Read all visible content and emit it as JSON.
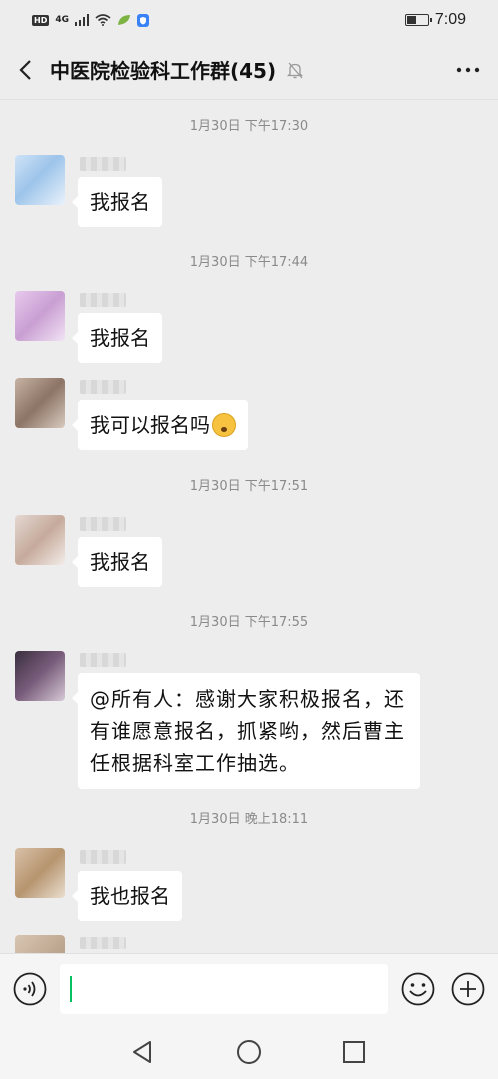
{
  "status_bar": {
    "network_badge": "HD",
    "signal": "4G",
    "time": "7:09",
    "battery_fraction": 0.4
  },
  "header": {
    "back_icon": "chevron-left-icon",
    "title": "中医院检验科工作群(45)",
    "mute_icon": "bell-off-icon",
    "more_icon": "more-horizontal-icon"
  },
  "messages": [
    {
      "time": "1月30日 下午17:30",
      "text": "我报名"
    },
    {
      "time": "1月30日 下午17:44",
      "text": "我报名"
    },
    {
      "text": "我可以报名吗",
      "emoji": "crying-face-emoji"
    },
    {
      "time": "1月30日 下午17:51",
      "text": "我报名"
    },
    {
      "time": "1月30日 下午17:55",
      "text": "@所有人：感谢大家积极报名，还有谁愿意报名，抓紧哟，然后曹主任根据科室工作抽选。"
    },
    {
      "time": "1月30日 晚上18:11",
      "text": "我也报名"
    }
  ],
  "input_bar": {
    "voice_icon": "voice-icon",
    "emoji_icon": "smiley-icon",
    "plus_icon": "plus-circle-icon"
  },
  "nav_bar": {
    "back_icon": "triangle-back-icon",
    "home_icon": "circle-home-icon",
    "recents_icon": "square-recents-icon"
  },
  "colors": {
    "background": "#ededed",
    "bubble": "#ffffff",
    "timestamp": "#8a8a8a",
    "cursor": "#07c160"
  }
}
